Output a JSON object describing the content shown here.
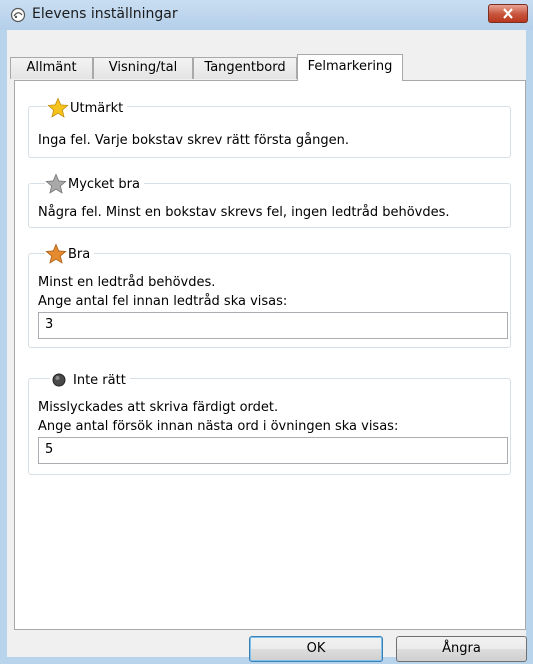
{
  "window": {
    "title": "Elevens inställningar"
  },
  "tabs": [
    {
      "label": "Allmänt"
    },
    {
      "label": "Visning/tal"
    },
    {
      "label": "Tangentbord"
    },
    {
      "label": "Felmarkering"
    }
  ],
  "groups": {
    "excellent": {
      "title": "Utmärkt",
      "description": "Inga fel. Varje bokstav skrev rätt första gången."
    },
    "very_good": {
      "title": "Mycket bra",
      "description": "Några fel. Minst en bokstav skrevs fel, ingen ledtråd behövdes."
    },
    "good": {
      "title": "Bra",
      "description": "Minst en ledtråd behövdes.",
      "field_label": "Ange antal fel innan ledtråd ska visas:",
      "field_value": "3"
    },
    "not_right": {
      "title": "Inte rätt",
      "description": "Misslyckades att skriva färdigt ordet.",
      "field_label": "Ange antal försök innan nästa ord i övningen ska visas:",
      "field_value": "5"
    }
  },
  "buttons": {
    "ok": "OK",
    "cancel": "Ångra"
  },
  "colors": {
    "gold_star": "#f5c31c",
    "silver_star": "#a9a9a9",
    "bronze_star": "#e48a2f",
    "close_red": "#c8533b"
  }
}
